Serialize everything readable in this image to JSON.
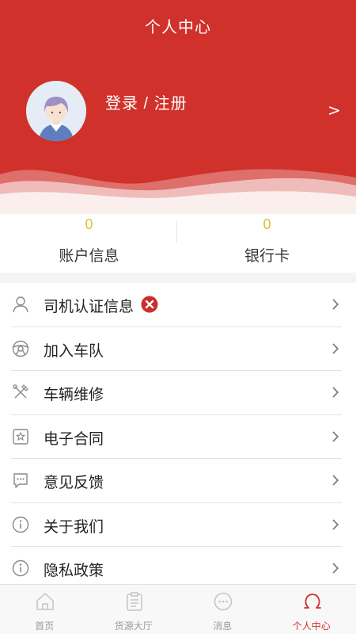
{
  "header": {
    "title": "个人中心",
    "login_label": "登录 / 注册",
    "arrow": ">",
    "accent_color": "#d0312b"
  },
  "stats": [
    {
      "value": "0",
      "label": "账户信息"
    },
    {
      "value": "0",
      "label": "银行卡"
    }
  ],
  "menu": {
    "items": [
      {
        "label": "司机认证信息",
        "icon": "person-icon",
        "status": "not-verified"
      },
      {
        "label": "加入车队",
        "icon": "steering-wheel-icon"
      },
      {
        "label": "车辆维修",
        "icon": "tools-icon"
      },
      {
        "label": "电子合同",
        "icon": "contract-icon"
      },
      {
        "label": "意见反馈",
        "icon": "feedback-icon"
      },
      {
        "label": "关于我们",
        "icon": "info-icon"
      },
      {
        "label": "隐私政策",
        "icon": "info-icon"
      }
    ]
  },
  "tabbar": {
    "tabs": [
      {
        "label": "首页",
        "icon": "home-icon",
        "active": false
      },
      {
        "label": "货源大厅",
        "icon": "clipboard-icon",
        "active": false
      },
      {
        "label": "消息",
        "icon": "message-icon",
        "active": false
      },
      {
        "label": "个人中心",
        "icon": "profile-icon",
        "active": true
      }
    ]
  }
}
